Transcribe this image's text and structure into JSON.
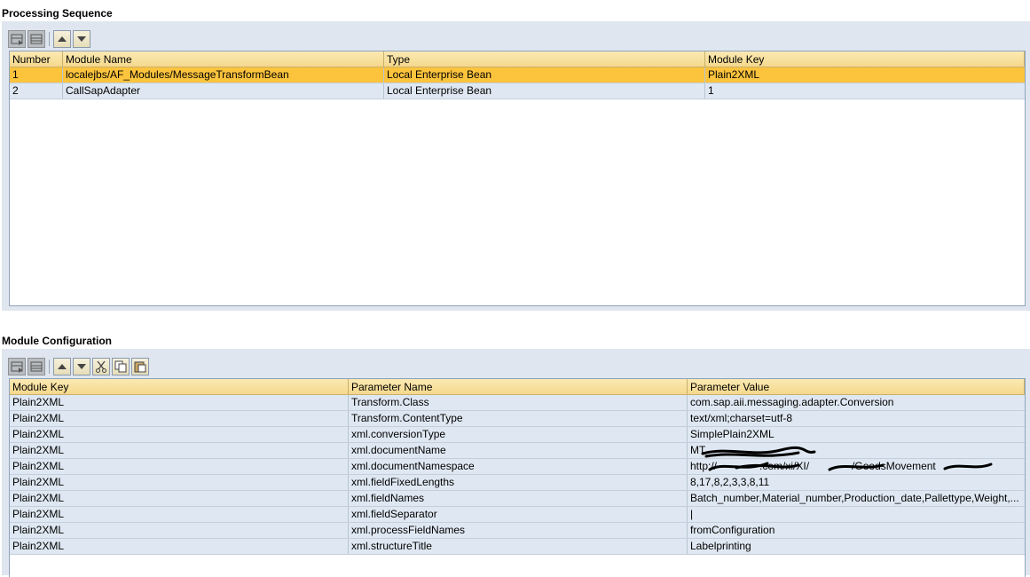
{
  "processing": {
    "title": "Processing Sequence",
    "columns": [
      "Number",
      "Module Name",
      "Type",
      "Module Key"
    ],
    "rows": [
      [
        "1",
        "localejbs/AF_Modules/MessageTransformBean",
        "Local Enterprise Bean",
        "Plain2XML"
      ],
      [
        "2",
        "CallSapAdapter",
        "Local Enterprise Bean",
        "1"
      ]
    ],
    "selected_row": 0
  },
  "module_config": {
    "title": "Module Configuration",
    "columns": [
      "Module Key",
      "Parameter Name",
      "Parameter Value"
    ],
    "rows": [
      [
        "Plain2XML",
        "Transform.Class",
        "com.sap.aii.messaging.adapter.Conversion"
      ],
      [
        "Plain2XML",
        "Transform.ContentType",
        "text/xml;charset=utf-8"
      ],
      [
        "Plain2XML",
        "xml.conversionType",
        "SimplePlain2XML"
      ],
      [
        "Plain2XML",
        "xml.documentName",
        "MT_"
      ],
      [
        "Plain2XML",
        "xml.documentNamespace",
        "http://",
        ".com/xi/XI/",
        "/GoodsMovement"
      ],
      [
        "Plain2XML",
        "xml.fieldFixedLengths",
        "8,17,8,2,3,3,8,11"
      ],
      [
        "Plain2XML",
        "xml.fieldNames",
        "Batch_number,Material_number,Production_date,Pallettype,Weight,..."
      ],
      [
        "Plain2XML",
        "xml.fieldSeparator",
        "|"
      ],
      [
        "Plain2XML",
        "xml.processFieldNames",
        "fromConfiguration"
      ],
      [
        "Plain2XML",
        "xml.structureTitle",
        "Labelprinting"
      ]
    ]
  },
  "icons": {
    "toolbar1": [
      "insert-row-icon",
      "delete-row-icon",
      "move-up-icon",
      "move-down-icon"
    ],
    "toolbar2": [
      "insert-row-icon",
      "delete-row-icon",
      "move-up-icon",
      "move-down-icon",
      "cut-icon",
      "copy-icon",
      "paste-icon"
    ]
  },
  "colors": {
    "header": "#f5d88d",
    "selected": "#fcc33d",
    "row": "#dfe8f2",
    "panel": "#dfe6ef"
  }
}
